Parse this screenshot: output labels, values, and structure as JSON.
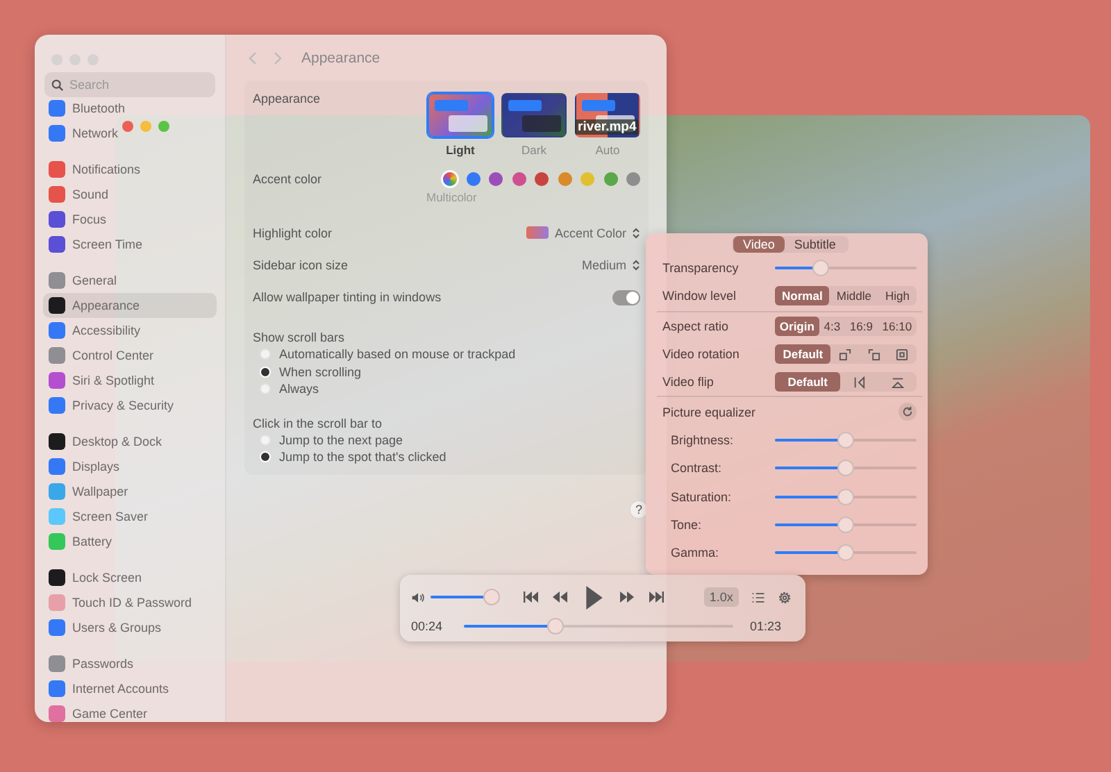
{
  "settings": {
    "search": {
      "placeholder": "Search"
    },
    "sidebar": {
      "groups": [
        [
          {
            "label": "Bluetooth",
            "color": "#3478f6",
            "selected": false
          },
          {
            "label": "Network",
            "color": "#3478f6",
            "selected": false
          }
        ],
        [
          {
            "label": "Notifications",
            "color": "#e5534b",
            "selected": false
          },
          {
            "label": "Sound",
            "color": "#e5534b",
            "selected": false
          },
          {
            "label": "Focus",
            "color": "#5b4fd6",
            "selected": false
          },
          {
            "label": "Screen Time",
            "color": "#5b4fd6",
            "selected": false
          }
        ],
        [
          {
            "label": "General",
            "color": "#8e8e93",
            "selected": false
          },
          {
            "label": "Appearance",
            "color": "#1c1c1e",
            "selected": true
          },
          {
            "label": "Accessibility",
            "color": "#3478f6",
            "selected": false
          },
          {
            "label": "Control Center",
            "color": "#8e8e93",
            "selected": false
          },
          {
            "label": "Siri & Spotlight",
            "color": "#b44fd0",
            "selected": false
          },
          {
            "label": "Privacy & Security",
            "color": "#3478f6",
            "selected": false
          }
        ],
        [
          {
            "label": "Desktop & Dock",
            "color": "#1c1c1e",
            "selected": false
          },
          {
            "label": "Displays",
            "color": "#3478f6",
            "selected": false
          },
          {
            "label": "Wallpaper",
            "color": "#3aa8e8",
            "selected": false
          },
          {
            "label": "Screen Saver",
            "color": "#5ac8fa",
            "selected": false
          },
          {
            "label": "Battery",
            "color": "#34c759",
            "selected": false
          }
        ],
        [
          {
            "label": "Lock Screen",
            "color": "#1c1c1e",
            "selected": false
          },
          {
            "label": "Touch ID & Password",
            "color": "#e8a0a8",
            "selected": false
          },
          {
            "label": "Users & Groups",
            "color": "#3478f6",
            "selected": false
          }
        ],
        [
          {
            "label": "Passwords",
            "color": "#8e8e93",
            "selected": false
          },
          {
            "label": "Internet Accounts",
            "color": "#3478f6",
            "selected": false
          },
          {
            "label": "Game Center",
            "color": "#e070a0",
            "selected": false
          }
        ]
      ]
    },
    "title": "Appearance",
    "appearance": {
      "label": "Appearance",
      "themes": [
        {
          "label": "Light",
          "kind": "light",
          "selected": true
        },
        {
          "label": "Dark",
          "kind": "dark",
          "selected": false
        },
        {
          "label": "Auto",
          "kind": "auto",
          "selected": false
        }
      ]
    },
    "accent": {
      "label": "Accent color",
      "caption": "Multicolor",
      "colors": [
        {
          "kind": "multi",
          "selected": true
        },
        {
          "kind": "solid",
          "color": "#3478f6",
          "selected": false
        },
        {
          "kind": "solid",
          "color": "#9a4fb8",
          "selected": false
        },
        {
          "kind": "solid",
          "color": "#d0508f",
          "selected": false
        },
        {
          "kind": "solid",
          "color": "#c8443e",
          "selected": false
        },
        {
          "kind": "solid",
          "color": "#d88a2c",
          "selected": false
        },
        {
          "kind": "solid",
          "color": "#e0c030",
          "selected": false
        },
        {
          "kind": "solid",
          "color": "#5aa848",
          "selected": false
        },
        {
          "kind": "solid",
          "color": "#8e8e8e",
          "selected": false
        }
      ]
    },
    "highlight": {
      "label": "Highlight color",
      "value": "Accent Color"
    },
    "icon_size": {
      "label": "Sidebar icon size",
      "value": "Medium"
    },
    "tinting": {
      "label": "Allow wallpaper tinting in windows",
      "on": true
    },
    "radio_groups": [
      {
        "label": "Show scroll bars",
        "options": [
          {
            "label": "Automatically based on mouse or trackpad",
            "selected": false
          },
          {
            "label": "When scrolling",
            "selected": true
          },
          {
            "label": "Always",
            "selected": false
          }
        ]
      },
      {
        "label": "Click in the scroll bar to",
        "options": [
          {
            "label": "Jump to the next page",
            "selected": false
          },
          {
            "label": "Jump to the spot that's clicked",
            "selected": true
          }
        ]
      }
    ],
    "help": "?"
  },
  "video": {
    "title": "river.mp4",
    "panel": {
      "tabs": [
        {
          "label": "Video",
          "selected": true
        },
        {
          "label": "Subtitle",
          "selected": false
        }
      ],
      "rows": [
        {
          "kind": "slider",
          "label": "Transparency",
          "level": 0.32
        },
        {
          "kind": "segmented",
          "label": "Window level",
          "segments": [
            {
              "kind": "text",
              "label": "Normal",
              "selected": true
            },
            {
              "kind": "text",
              "label": "Middle",
              "selected": false
            },
            {
              "kind": "text",
              "label": "High",
              "selected": false
            }
          ]
        },
        {
          "kind": "divider"
        },
        {
          "kind": "segmented",
          "label": "Aspect ratio",
          "segments": [
            {
              "kind": "text",
              "label": "Origin",
              "selected": true
            },
            {
              "kind": "text",
              "label": "4:3",
              "selected": false
            },
            {
              "kind": "text",
              "label": "16:9",
              "selected": false
            },
            {
              "kind": "text",
              "label": "16:10",
              "selected": false
            }
          ]
        },
        {
          "kind": "segmented",
          "label": "Video rotation",
          "segments": [
            {
              "kind": "text",
              "label": "Default",
              "selected": true
            },
            {
              "kind": "rotccw",
              "selected": false
            },
            {
              "kind": "rotcw",
              "selected": false
            },
            {
              "kind": "reset",
              "selected": false
            }
          ]
        },
        {
          "kind": "segmented",
          "label": "Video flip",
          "segments": [
            {
              "kind": "text",
              "label": "Default",
              "selected": true
            },
            {
              "kind": "fliph",
              "selected": false
            },
            {
              "kind": "flipv",
              "selected": false
            }
          ]
        },
        {
          "kind": "divider"
        },
        {
          "kind": "header",
          "label": "Picture equalizer"
        },
        {
          "kind": "eq",
          "label": "Brightness:",
          "level": 0.5
        },
        {
          "kind": "eq",
          "label": "Contrast:",
          "level": 0.5
        },
        {
          "kind": "eq",
          "label": "Saturation:",
          "level": 0.5
        },
        {
          "kind": "eq",
          "label": "Tone:",
          "level": 0.5
        },
        {
          "kind": "eq",
          "label": "Gamma:",
          "level": 0.5
        }
      ]
    },
    "controls": {
      "volume": {
        "level": 0.95
      },
      "speed": "1.0x",
      "elapsed": "00:24",
      "progress": {
        "level": 0.34
      },
      "duration": "01:23"
    }
  }
}
